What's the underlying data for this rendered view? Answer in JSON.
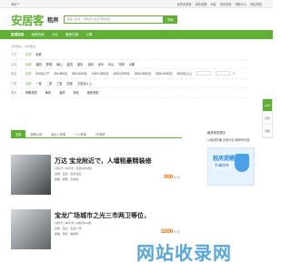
{
  "topbar": {
    "city": "深圳",
    "links": [
      "我的安居客",
      "我的收藏",
      "消息",
      "发布房源",
      "帮助中心",
      "网站导航"
    ]
  },
  "brand": {
    "logo": "安居客",
    "section": "租房"
  },
  "search": {
    "placeholder": "请输入区域、商圈或小区名开始找房",
    "button": "搜索"
  },
  "nav": [
    "区域找房",
    "地铁找房",
    "小区",
    "看房日报",
    "公寓"
  ],
  "breadcrumb": "深圳租房 > 深圳租房",
  "filters": {
    "type": {
      "label": "方式",
      "options": [
        "区域",
        "地铁"
      ]
    },
    "region": {
      "label": "区域",
      "options": [
        "全部",
        "福田",
        "罗湖",
        "南山",
        "盐田",
        "宝安",
        "龙岗",
        "龙华",
        "坪山",
        "光明",
        "大鹏"
      ]
    },
    "rent": {
      "label": "租金",
      "options": [
        "全部",
        "500元以下",
        "500-800元",
        "800-1000元",
        "1000-1500元",
        "1500-2000元",
        "2000-3000元",
        "3000-5000元",
        "5000元以上"
      ],
      "unit": "元",
      "confirm": "确定"
    },
    "rooms": {
      "label": "户型",
      "options": [
        "全部",
        "一室",
        "二室",
        "三室",
        "四室",
        "五室及以上"
      ]
    },
    "more": {
      "label": "更多",
      "dropdowns": [
        "房屋类型",
        "朝向",
        "装修",
        "特色",
        "租房类型"
      ]
    }
  },
  "tabs": [
    "全部",
    "品牌公寓",
    "经纪人房源",
    "个人房源",
    "VR看房"
  ],
  "listings": [
    {
      "title": "万达 宝龙附近で，人墙租豪精装修",
      "meta1": "1室1厅 | 35平米 | 高层(共20层)",
      "meta2": "龙岗 - 宝龙 - 宝龙社区",
      "tags": "整租 · 朝南 · 近地铁",
      "price": "900",
      "price_unit": "元/月"
    },
    {
      "title": "宝龙广场城市之光三市两卫等位，",
      "meta1": "3室2厅 | 88平米 | 中层(共32层)",
      "meta2": "龙岗 - 宝龙 - 宝龙广场",
      "tags": "整租 · 南北 · 精装修",
      "price": "3200",
      "price_unit": "元/月"
    }
  ],
  "sidebar": {
    "title": "租房风险提示",
    "notice": "以租房防骗 大部分请 期间有可能",
    "ad_caption": "租房提醒",
    "ad_sub": "防骗指南"
  },
  "rail": [
    "APP",
    "反馈",
    "顶部"
  ],
  "watermark": "网站收录网"
}
